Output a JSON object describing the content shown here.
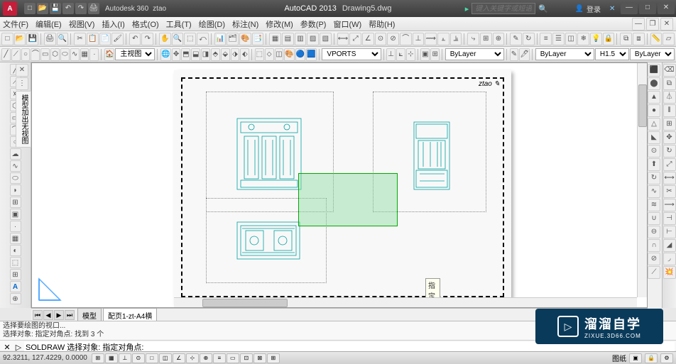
{
  "title": {
    "app": "AutoCAD 2013",
    "doc": "Drawing5.dwg",
    "user": "ztao"
  },
  "search": {
    "placeholder": "键入关键字或短语"
  },
  "login": {
    "label": "登录"
  },
  "menu": [
    "文件(F)",
    "编辑(E)",
    "视图(V)",
    "插入(I)",
    "格式(O)",
    "工具(T)",
    "绘图(D)",
    "标注(N)",
    "修改(M)",
    "参数(P)",
    "窗口(W)",
    "帮助(H)"
  ],
  "combos": {
    "viewname": "主视图",
    "vports": "VPORTS",
    "layer": "ByLayer",
    "layer2": "ByLayer",
    "layer3": "ByLayer",
    "h": "H1.5"
  },
  "tooltip": "指定对角点:",
  "signature": "ztao ✎",
  "tabs": {
    "model": "模型",
    "layout": "配页1-zt-A4横"
  },
  "cmd": {
    "line1": "选择要绘图的视口...",
    "line2": "选择对象: 指定对角点: 找到 3 个",
    "prompt": "SOLDRAW 选择对象: 指定对角点:"
  },
  "status": {
    "coords": "92.3211, 127.4229, 0.0000",
    "paperspace": "图纸"
  },
  "watermark": {
    "main": "溜溜自学",
    "sub": "ZIXUE.3D66.COM"
  },
  "palette": "模型加出无视图"
}
